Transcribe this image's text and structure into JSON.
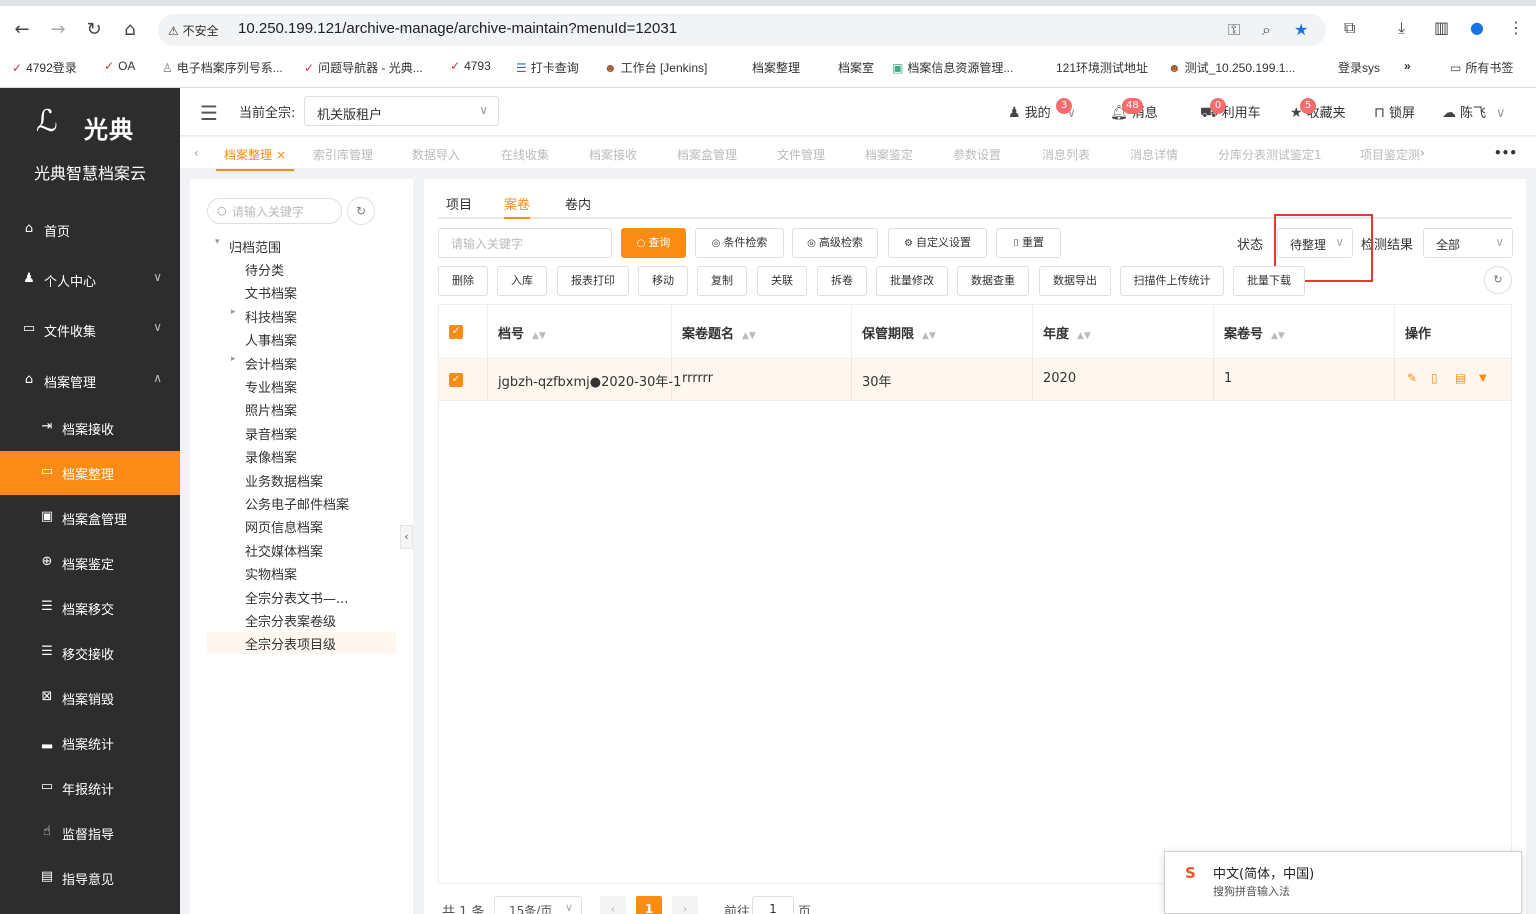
{
  "browser": {
    "insecure_label": "不安全",
    "url": "10.250.199.121/archive-manage/archive-maintain?menuId=12031",
    "bookmarks": [
      "4792登录",
      "OA",
      "电子档案序列号系...",
      "问题导航器 - 光典...",
      "4793",
      "打卡查询",
      "工作台 [Jenkins]",
      "档案整理",
      "档案室",
      "档案信息资源管理...",
      "121环境测试地址",
      "测试_10.250.199.1...",
      "登录sys",
      "所有书签"
    ]
  },
  "sidebar": {
    "logo_text": "光典",
    "brand": "光典智慧档案云",
    "items": [
      {
        "label": "首页",
        "icon": "home-icon",
        "glyph": "⌂"
      },
      {
        "label": "个人中心",
        "icon": "user-icon",
        "glyph": "♟"
      },
      {
        "label": "文件收集",
        "icon": "folder-icon",
        "glyph": "▭"
      },
      {
        "label": "档案管理",
        "icon": "archive-icon",
        "glyph": "⌂"
      },
      {
        "label": "档案接收",
        "icon": "receive-icon",
        "glyph": "⇥"
      },
      {
        "label": "档案整理",
        "icon": "folder-open-icon",
        "glyph": "▭"
      },
      {
        "label": "档案盒管理",
        "icon": "box-icon",
        "glyph": "▣"
      },
      {
        "label": "档案鉴定",
        "icon": "compass-icon",
        "glyph": "⊕"
      },
      {
        "label": "档案移交",
        "icon": "list-icon",
        "glyph": "☰"
      },
      {
        "label": "移交接收",
        "icon": "list-icon",
        "glyph": "☰"
      },
      {
        "label": "档案销毁",
        "icon": "destroy-icon",
        "glyph": "⊠"
      },
      {
        "label": "档案统计",
        "icon": "bar-chart-icon",
        "glyph": "▂"
      },
      {
        "label": "年报统计",
        "icon": "monitor-icon",
        "glyph": "▭"
      },
      {
        "label": "监督指导",
        "icon": "hand-icon",
        "glyph": "☝"
      },
      {
        "label": "指导意见",
        "icon": "comment-icon",
        "glyph": "▤"
      }
    ]
  },
  "header": {
    "tenant_label": "当前全宗:",
    "tenant_value": "机关版租户",
    "mine": "我的",
    "mine_badge": "3",
    "messages": "消息",
    "messages_badge": "48",
    "cart": "利用车",
    "cart_badge": "0",
    "favorites": "收藏夹",
    "favorites_badge": "5",
    "lock": "锁屏",
    "user": "陈飞"
  },
  "page_tabs": [
    "档案整理",
    "索引库管理",
    "数据导入",
    "在线收集",
    "档案接收",
    "档案盒管理",
    "文件管理",
    "档案鉴定",
    "参数设置",
    "消息列表",
    "消息详情",
    "分库分表测试鉴定1",
    "项目鉴定测"
  ],
  "tree": {
    "search_placeholder": "请输入关键字",
    "root": "归档范围",
    "nodes": [
      "待分类",
      "文书档案",
      "科技档案",
      "人事档案",
      "会计档案",
      "专业档案",
      "照片档案",
      "录音档案",
      "录像档案",
      "业务数据档案",
      "公务电子邮件档案",
      "网页信息档案",
      "社交媒体档案",
      "实物档案",
      "全宗分表文书—...",
      "全宗分表案卷级",
      "全宗分表项目级"
    ]
  },
  "main": {
    "subtabs": [
      "项目",
      "案卷",
      "卷内"
    ],
    "keyword_placeholder": "请输入关键字",
    "buttons_row1": [
      "查询",
      "条件检索",
      "高级检索",
      "自定义设置",
      "重置"
    ],
    "status_label": "状态",
    "status_value": "待整理",
    "check_label": "检测结果",
    "check_value": "全部",
    "buttons_row2": [
      "删除",
      "入库",
      "报表打印",
      "移动",
      "复制",
      "关联",
      "拆卷",
      "批量修改",
      "数据查重",
      "数据导出",
      "扫描件上传统计",
      "批量下载"
    ],
    "columns": [
      "档号",
      "案卷题名",
      "保管期限",
      "年度",
      "案卷号",
      "操作"
    ],
    "rows": [
      {
        "code": "jgbzh-qzfbxmj●2020-30年-1",
        "title": "rrrrrr",
        "period": "30年",
        "year": "2020",
        "volume": "1"
      }
    ]
  },
  "pager": {
    "total": "共 1 条",
    "size": "15条/页",
    "current": "1",
    "goto": "前往",
    "goto_value": "1",
    "unit": "页"
  },
  "ime": {
    "line1": "中文(简体，中国)",
    "line2": "搜狗拼音输入法"
  },
  "colors": {
    "accent": "#fa8c16",
    "sidebar": "#2d2d2d",
    "highlight_box": "#e53935"
  }
}
